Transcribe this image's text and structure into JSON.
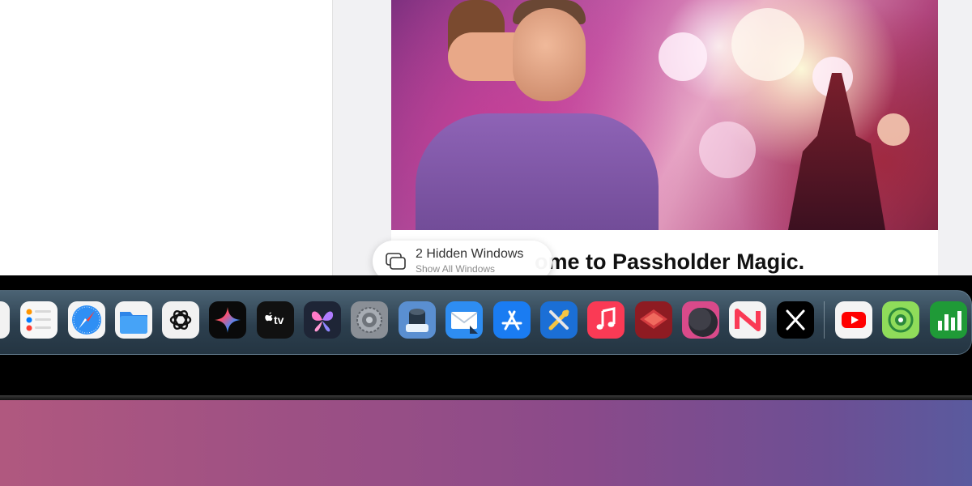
{
  "hidden_windows": {
    "title": "2 Hidden Windows",
    "subtitle": "Show All Windows",
    "icon": "windows-stack-icon"
  },
  "article": {
    "title": "ome to Passholder Magic."
  },
  "dock": {
    "apps": [
      {
        "name": "partial-app",
        "icon": "app-icon"
      },
      {
        "name": "reminders",
        "icon": "reminders-icon"
      },
      {
        "name": "safari",
        "icon": "safari-icon"
      },
      {
        "name": "files",
        "icon": "files-icon"
      },
      {
        "name": "chatgpt",
        "icon": "chatgpt-icon"
      },
      {
        "name": "gemini",
        "icon": "gemini-icon"
      },
      {
        "name": "apple-tv",
        "icon": "apple-tv-icon",
        "label": "tv"
      },
      {
        "name": "butterfly",
        "icon": "butterfly-icon"
      },
      {
        "name": "settings",
        "icon": "gear-icon"
      },
      {
        "name": "preview",
        "icon": "preview-icon"
      },
      {
        "name": "mail",
        "icon": "mail-icon"
      },
      {
        "name": "app-store",
        "icon": "app-store-icon"
      },
      {
        "name": "xcode-tools",
        "icon": "tools-icon"
      },
      {
        "name": "music",
        "icon": "music-icon"
      },
      {
        "name": "book-app",
        "icon": "book-icon"
      },
      {
        "name": "nightshade",
        "icon": "moon-icon"
      },
      {
        "name": "news",
        "icon": "news-icon"
      },
      {
        "name": "x",
        "icon": "x-icon"
      },
      {
        "name": "youtube",
        "icon": "youtube-icon"
      },
      {
        "name": "find-my",
        "icon": "find-my-icon"
      },
      {
        "name": "numbers",
        "icon": "numbers-icon"
      }
    ]
  },
  "colors": {
    "dock_top": "#4b6374",
    "dock_bottom": "#243542",
    "wallpaper_left": "#b0587f",
    "wallpaper_right": "#5a5a9e"
  }
}
